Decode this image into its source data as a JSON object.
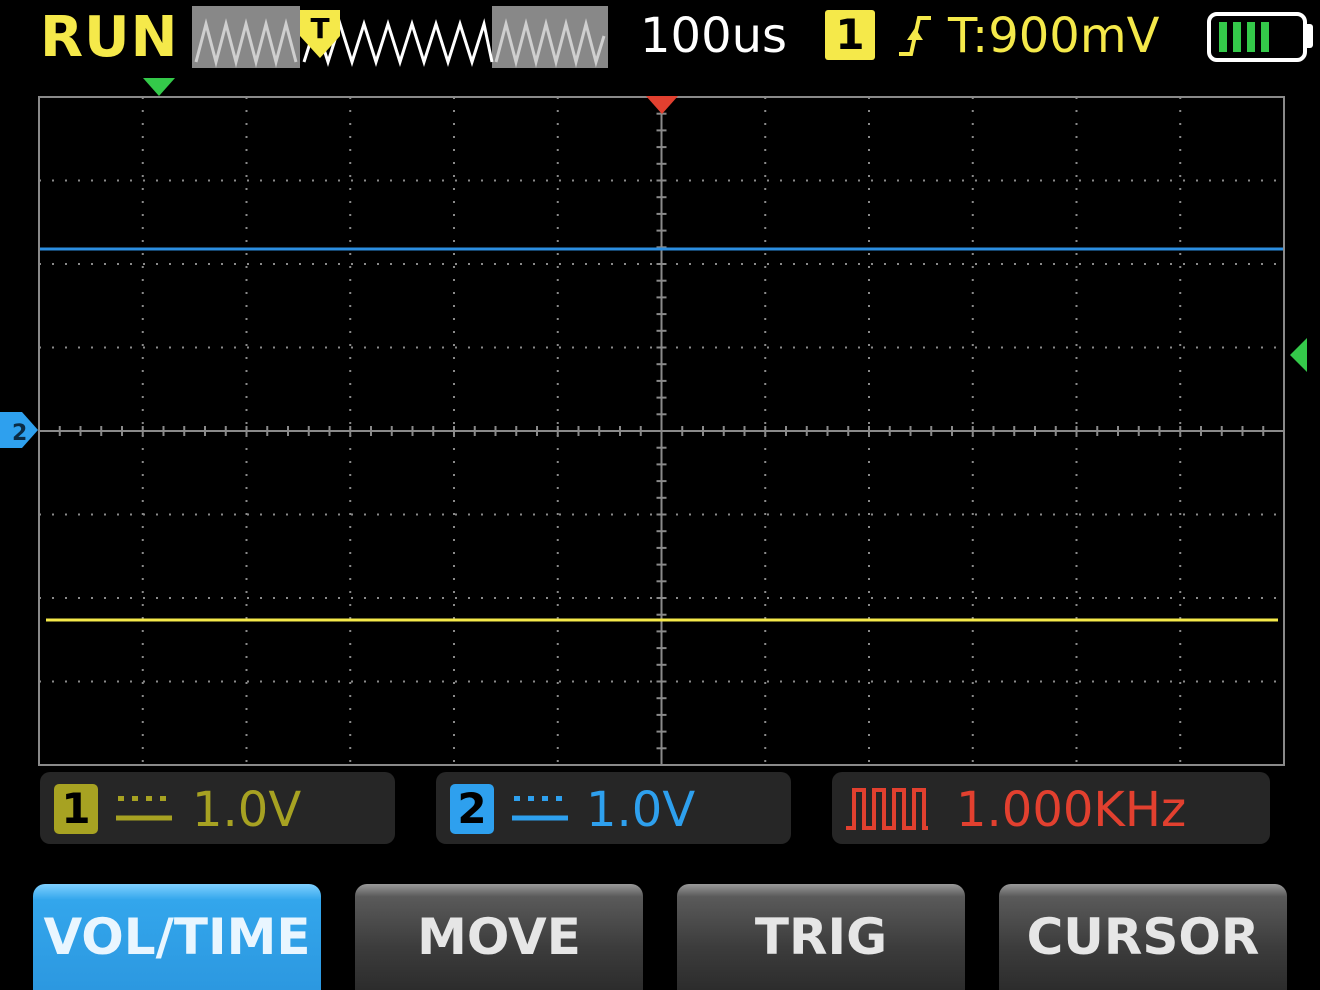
{
  "status": {
    "run_state": "RUN"
  },
  "header": {
    "timebase": "100us",
    "trigger_channel": "1",
    "trigger_marker": "T",
    "trigger_edge_icon": "rising-edge-icon",
    "trigger_level": "T:900mV",
    "battery_icon": "battery-icon"
  },
  "channels": [
    {
      "badge": "1",
      "scale": "1.0V",
      "color": "#f5e94a",
      "badge_color": "#a7a222",
      "text_color": "#a7a222",
      "coupling_icon": "dc-coupling-icon"
    },
    {
      "badge": "2",
      "scale": "1.0V",
      "color": "#2c8ee0",
      "badge_color": "#2ea0ee",
      "text_color": "#2ea0ee",
      "coupling_icon": "dc-coupling-icon"
    }
  ],
  "generator": {
    "frequency": "1.000KHz",
    "color": "#e2402f",
    "icon": "square-wave-icon"
  },
  "softkeys": [
    {
      "label": "VOL/TIME",
      "active": true
    },
    {
      "label": "MOVE",
      "active": false
    },
    {
      "label": "TRIG",
      "active": false
    },
    {
      "label": "CURSOR",
      "active": false
    }
  ],
  "colors": {
    "run": "#f5e94a",
    "grid": "#8a8a8a",
    "trace_ch1": "#f5e94a",
    "trace_ch2": "#2c8ee0",
    "trigger_marker": "#e2402f",
    "battery_fill": "#34c94a"
  }
}
